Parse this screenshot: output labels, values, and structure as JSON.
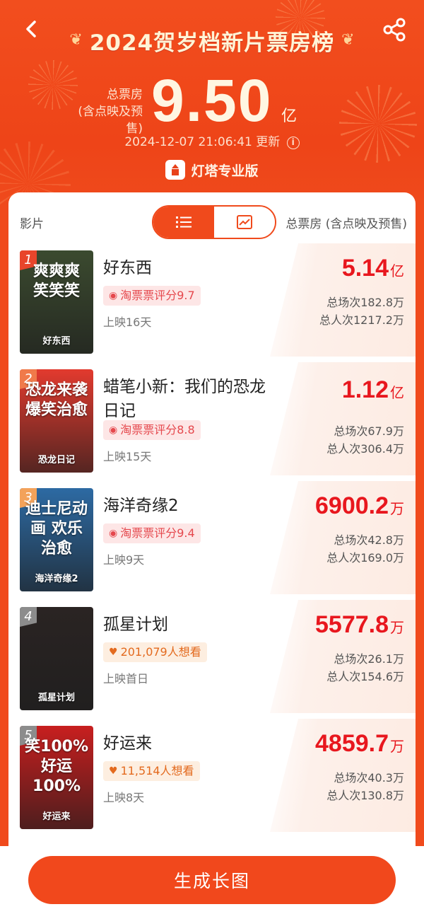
{
  "header": {
    "title": "2024贺岁档新片票房榜",
    "total_label_line1": "总票房",
    "total_label_line2": "(含点映及预售)",
    "total_value": "9.50",
    "total_unit": "亿",
    "update_time": "2024-12-07 21:06:41",
    "update_suffix": "更新",
    "brand": "灯塔专业版"
  },
  "list_header": {
    "film_col": "影片",
    "box_col": "总票房 (含点映及预售)"
  },
  "films": [
    {
      "rank": "1",
      "title": "好东西",
      "tag_text": "淘票票评分9.7",
      "tag_type": "score",
      "days": "上映16天",
      "gross": "5.14",
      "gross_unit": "亿",
      "shows": "总场次182.8万",
      "admissions": "总人次1217.2万",
      "poster_text": "爽爽爽 笑笑笑",
      "poster_sub": "好东西",
      "poster_color": "#3b4a2f",
      "rank_color": "#e8452b"
    },
    {
      "rank": "2",
      "title": "蜡笔小新：我们的恐龙日记",
      "tag_text": "淘票票评分8.8",
      "tag_type": "score",
      "days": "上映15天",
      "gross": "1.12",
      "gross_unit": "亿",
      "shows": "总场次67.9万",
      "admissions": "总人次306.4万",
      "poster_text": "恐龙来袭 爆笑治愈",
      "poster_sub": "恐龙日记",
      "poster_color": "#e23a2e",
      "rank_color": "#f07a4a"
    },
    {
      "rank": "3",
      "title": "海洋奇缘2",
      "tag_text": "淘票票评分9.4",
      "tag_type": "score",
      "days": "上映9天",
      "gross": "6900.2",
      "gross_unit": "万",
      "shows": "总场次42.8万",
      "admissions": "总人次169.0万",
      "poster_text": "迪士尼动画 欢乐治愈",
      "poster_sub": "海洋奇缘2",
      "poster_color": "#2d6aa3",
      "rank_color": "#f3a25a"
    },
    {
      "rank": "4",
      "title": "孤星计划",
      "tag_text": "201,079人想看",
      "tag_type": "want",
      "days": "上映首日",
      "gross": "5577.8",
      "gross_unit": "万",
      "shows": "总场次26.1万",
      "admissions": "总人次154.6万",
      "poster_text": "",
      "poster_sub": "孤星计划",
      "poster_color": "#2a2423",
      "rank_color": "#8c8c8c"
    },
    {
      "rank": "5",
      "title": "好运来",
      "tag_text": "11,514人想看",
      "tag_type": "want",
      "days": "上映8天",
      "gross": "4859.7",
      "gross_unit": "万",
      "shows": "总场次40.3万",
      "admissions": "总人次130.8万",
      "poster_text": "笑100% 好运100%",
      "poster_sub": "好运来",
      "poster_color": "#c81f1f",
      "rank_color": "#8c8c8c"
    }
  ],
  "footer": {
    "button_label": "生成长图"
  },
  "colors": {
    "brand": "#f04a1c",
    "gross": "#e8171e"
  }
}
